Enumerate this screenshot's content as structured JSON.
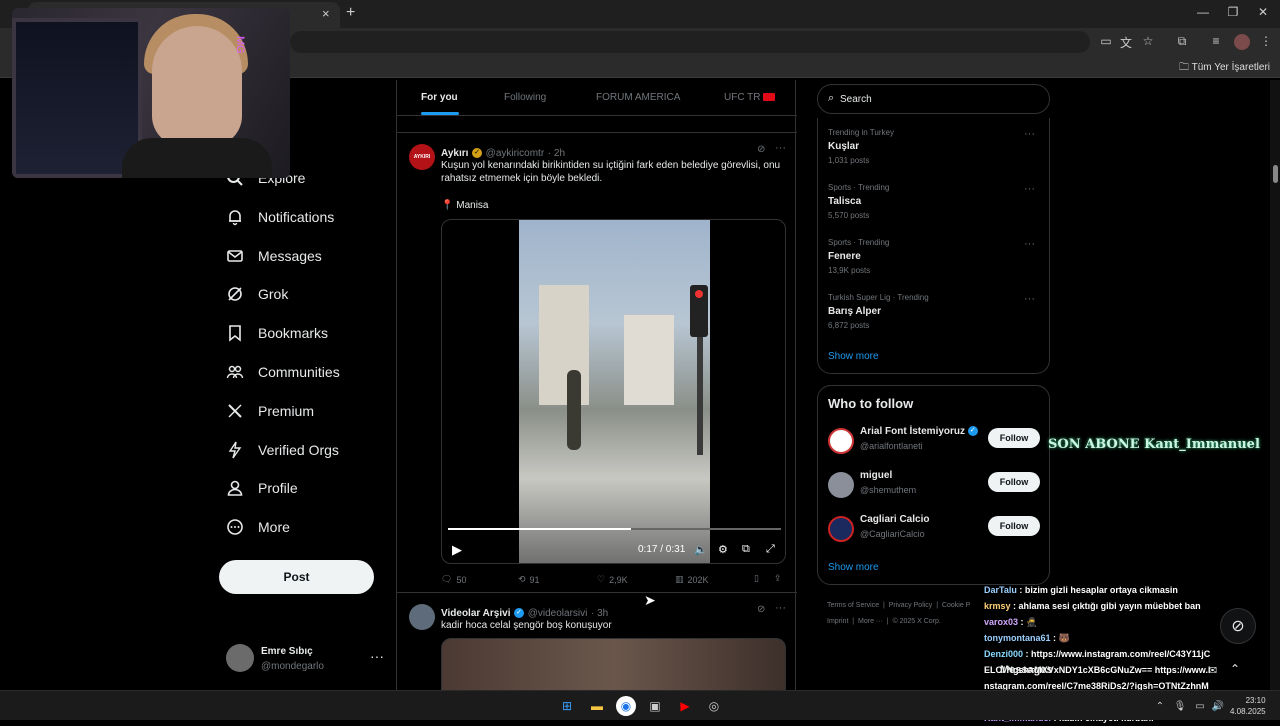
{
  "browser": {
    "bookmarks_label": "Tüm Yer İşaretleri",
    "tab_close": "×",
    "new_tab": "+"
  },
  "webcam": {
    "overlay_text": "MG"
  },
  "nav": {
    "items": [
      {
        "label": "Explore",
        "icon": "search-icon"
      },
      {
        "label": "Notifications",
        "icon": "bell-icon"
      },
      {
        "label": "Messages",
        "icon": "mail-icon"
      },
      {
        "label": "Grok",
        "icon": "grok-icon"
      },
      {
        "label": "Bookmarks",
        "icon": "bookmark-icon"
      },
      {
        "label": "Communities",
        "icon": "people-icon"
      },
      {
        "label": "Premium",
        "icon": "x-logo-icon"
      },
      {
        "label": "Verified Orgs",
        "icon": "lightning-icon"
      },
      {
        "label": "Profile",
        "icon": "person-icon"
      },
      {
        "label": "More",
        "icon": "more-circle-icon"
      }
    ],
    "post_label": "Post",
    "account": {
      "name": "Emre Sıbıç",
      "handle": "@mondegarlo",
      "more": "···"
    }
  },
  "timeline": {
    "tabs": [
      "For you",
      "Following",
      "FORUM AMERICA",
      "UFC TR"
    ],
    "active_tab": "For you",
    "tweets": [
      {
        "name": "Aykırı",
        "handle": "@aykiricomtr",
        "time": "· 2h",
        "avatar_text": "AYKIRI",
        "text": "Kuşun yol kenarındaki birikintiden su içtiğini fark eden belediye görevlisi, onu rahatsız etmemek için böyle bekledi.",
        "location": "Manisa",
        "video": {
          "time": "0:17 / 0:31",
          "progress": 0.55
        },
        "stats": {
          "replies": "50",
          "reposts": "91",
          "likes": "2,9K",
          "views": "202K"
        }
      },
      {
        "name": "Videolar Arşivi",
        "handle": "@videolarsivi",
        "time": "· 3h",
        "text": "kadir hoca celal şengör boş konuşuyor"
      }
    ]
  },
  "sidebar": {
    "search_placeholder": "Search",
    "trends": [
      {
        "context": "Trending in Turkey",
        "title": "Kuşlar",
        "count": "1,031 posts"
      },
      {
        "context": "Sports · Trending",
        "title": "Talisca",
        "count": "5,570 posts"
      },
      {
        "context": "Sports · Trending",
        "title": "Fenere",
        "count": "13,9K posts"
      },
      {
        "context": "Turkish Super Lig · Trending",
        "title": "Barış Alper",
        "count": "6,872 posts"
      }
    ],
    "show_more": "Show more",
    "who_to_follow": {
      "title": "Who to follow",
      "accounts": [
        {
          "name": "Arial Font İstemiyoruz",
          "handle": "@arialfontlaneti",
          "button": "Follow"
        },
        {
          "name": "miguel",
          "handle": "@shemuthem",
          "button": "Follow"
        },
        {
          "name": "Cagliari Calcio",
          "handle": "@CagliariCalcio",
          "button": "Follow"
        }
      ],
      "show_more": "Show more"
    },
    "footer": {
      "line1": [
        "Terms of Service",
        "Privacy Policy",
        "Cookie P"
      ],
      "line2": [
        "Imprint",
        "More ···",
        "© 2025 X Corp."
      ]
    }
  },
  "overlays": {
    "abone": "SON ABONE Kant_Immanuel",
    "chat": [
      {
        "user": "DarTalu",
        "msg": ": bizim gizli hesaplar ortaya cikmasin"
      },
      {
        "user": "krmsy",
        "msg": ": ahlama sesi çıktığı gibi yayın müebbet ban"
      },
      {
        "user": "varox03",
        "msg": ": 🥷"
      },
      {
        "user": "tonymontana61",
        "msg": ": 🐻"
      },
      {
        "user": "Denzi000",
        "msg": ": https://www.instagram.com/reel/C43Y11jCELO/?igsh=MXVxNDY1cXB6cGNuZw== https://www.instagram.com/reel/C7me38RiDs2/?igsh=OTNtZzhnMDI3Zmx0 şu ikisi favorim"
      },
      {
        "user": "Kant_Immanuel",
        "msg": ": kadın cinayeti kurbanı"
      }
    ],
    "messages_drawer": "Messages"
  },
  "taskbar": {
    "time": "23:10",
    "date": "4.08.2025"
  }
}
